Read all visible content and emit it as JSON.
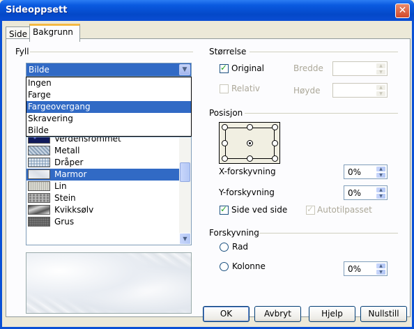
{
  "window": {
    "title": "Sideoppsett",
    "close_glyph": "✕"
  },
  "tabs": [
    {
      "label": "Side",
      "active": false
    },
    {
      "label": "Bakgrunn",
      "active": true
    }
  ],
  "fill": {
    "group_label": "Fyll",
    "selected_value": "Bilde",
    "dropdown_options": [
      "Ingen",
      "Farge",
      "Fargeovergang",
      "Skravering",
      "Bilde"
    ],
    "dropdown_highlighted": "Fargeovergang",
    "bitmap_list": [
      {
        "label": "Verdensrommet",
        "selected": false
      },
      {
        "label": "Metall",
        "selected": false
      },
      {
        "label": "Dråper",
        "selected": false
      },
      {
        "label": "Marmor",
        "selected": true
      },
      {
        "label": "Lin",
        "selected": false
      },
      {
        "label": "Stein",
        "selected": false
      },
      {
        "label": "Kvikksølv",
        "selected": false
      },
      {
        "label": "Grus",
        "selected": false
      }
    ]
  },
  "size": {
    "group_label": "Størrelse",
    "original_label": "Original",
    "original_checked": true,
    "relative_label": "Relativ",
    "relative_checked": false,
    "width_label": "Bredde",
    "height_label": "Høyde",
    "width_value": "",
    "height_value": ""
  },
  "position": {
    "group_label": "Posisjon",
    "selected_point": "center",
    "x_offset_label": "X-forskyvning",
    "x_offset_value": "0%",
    "y_offset_label": "Y-forskyvning",
    "y_offset_value": "0%",
    "tile_label": "Side ved side",
    "tile_checked": true,
    "autofit_label": "Autotilpasset",
    "autofit_checked": true
  },
  "offset": {
    "group_label": "Forskyvning",
    "row_label": "Rad",
    "column_label": "Kolonne",
    "value": "0%"
  },
  "buttons": {
    "ok": "OK",
    "cancel": "Avbryt",
    "help": "Hjelp",
    "reset": "Nullstill"
  },
  "colors": {
    "title_bar": "#0a5ae0",
    "selection": "#316ac5",
    "dialog_bg": "#ece9d8",
    "tab_accent": "#f5b942"
  }
}
